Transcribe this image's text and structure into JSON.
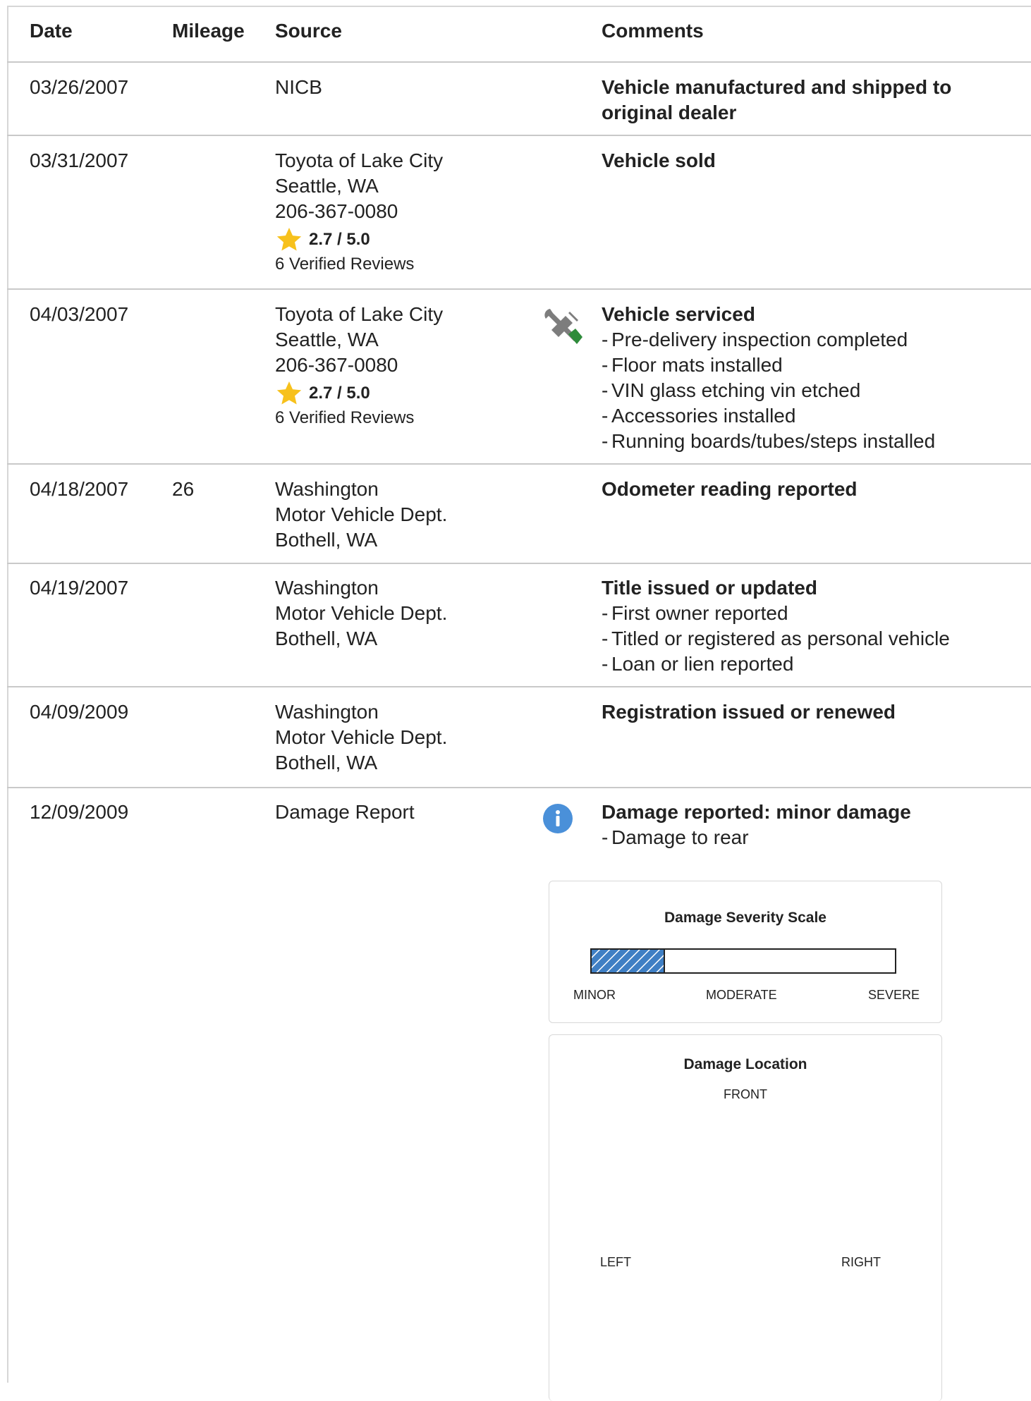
{
  "headers": {
    "date": "Date",
    "mileage": "Mileage",
    "source": "Source",
    "comments": "Comments"
  },
  "rows": [
    {
      "date": "03/26/2007",
      "mileage": "",
      "source": [
        "NICB"
      ],
      "title_lines": [
        "Vehicle manufactured and shipped to",
        "original dealer"
      ],
      "details": []
    },
    {
      "date": "03/31/2007",
      "mileage": "",
      "source": [
        "Toyota of Lake City",
        "Seattle, WA",
        "206-367-0080"
      ],
      "rating": "2.7 / 5.0",
      "reviews": "6 Verified Reviews",
      "title_lines": [
        "Vehicle sold"
      ],
      "details": []
    },
    {
      "date": "04/03/2007",
      "mileage": "",
      "source": [
        "Toyota of Lake City",
        "Seattle, WA",
        "206-367-0080"
      ],
      "rating": "2.7 / 5.0",
      "reviews": "6 Verified Reviews",
      "icon": "wrench-screwdriver-icon",
      "title_lines": [
        "Vehicle serviced"
      ],
      "details": [
        "Pre-delivery inspection completed",
        "Floor mats installed",
        "VIN glass etching vin etched",
        "Accessories installed",
        "Running boards/tubes/steps installed"
      ]
    },
    {
      "date": "04/18/2007",
      "mileage": "26",
      "source": [
        "Washington",
        "Motor Vehicle Dept.",
        "Bothell, WA"
      ],
      "title_lines": [
        "Odometer reading reported"
      ],
      "details": []
    },
    {
      "date": "04/19/2007",
      "mileage": "",
      "source": [
        "Washington",
        "Motor Vehicle Dept.",
        "Bothell, WA"
      ],
      "title_lines": [
        "Title issued or updated"
      ],
      "details": [
        "First owner reported",
        "Titled or registered as personal vehicle",
        "Loan or lien reported"
      ]
    },
    {
      "date": "04/09/2009",
      "mileage": "",
      "source": [
        "Washington",
        "Motor Vehicle Dept.",
        "Bothell, WA"
      ],
      "title_lines": [
        "Registration issued or renewed"
      ],
      "details": []
    },
    {
      "date": "12/09/2009",
      "mileage": "",
      "source": [
        "Damage Report"
      ],
      "icon": "info-icon",
      "title_lines": [
        "Damage reported: minor damage"
      ],
      "details": [
        "Damage to rear"
      ]
    }
  ],
  "severity": {
    "title": "Damage Severity Scale",
    "labels": [
      "MINOR",
      "MODERATE",
      "SEVERE"
    ],
    "level": 0.24
  },
  "location": {
    "title": "Damage Location",
    "front": "FRONT",
    "left": "LEFT",
    "right": "RIGHT"
  },
  "colors": {
    "star": "#f7c11c",
    "info": "#4a90d9",
    "hatch": "#3f7fc4",
    "wrench": "#7d7d7d",
    "screwdriver": "#2e8b3a"
  }
}
